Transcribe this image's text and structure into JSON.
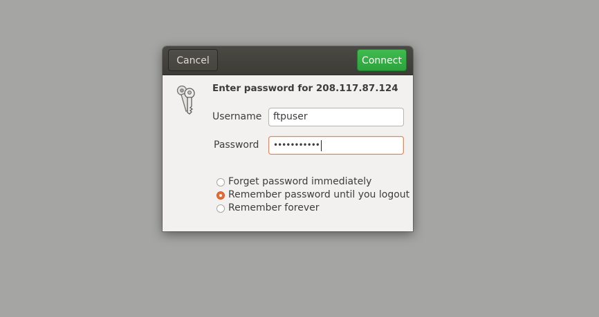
{
  "dialog": {
    "cancel_label": "Cancel",
    "connect_label": "Connect",
    "icon": "keys-icon",
    "prompt": "Enter password for 208.117.87.124",
    "username_label": "Username",
    "username_value": "ftpuser",
    "password_label": "Password",
    "password_value": "•••••••••••",
    "remember_options": [
      {
        "label": "Forget password immediately",
        "selected": false
      },
      {
        "label": "Remember password until you logout",
        "selected": true
      },
      {
        "label": "Remember forever",
        "selected": false
      }
    ]
  },
  "colors": {
    "desktop_background": "#a5a5a3",
    "header_background": "#3d3c37",
    "connect_button": "#33a843",
    "focus_accent": "#e9844a",
    "radio_selected": "#e96a32"
  }
}
